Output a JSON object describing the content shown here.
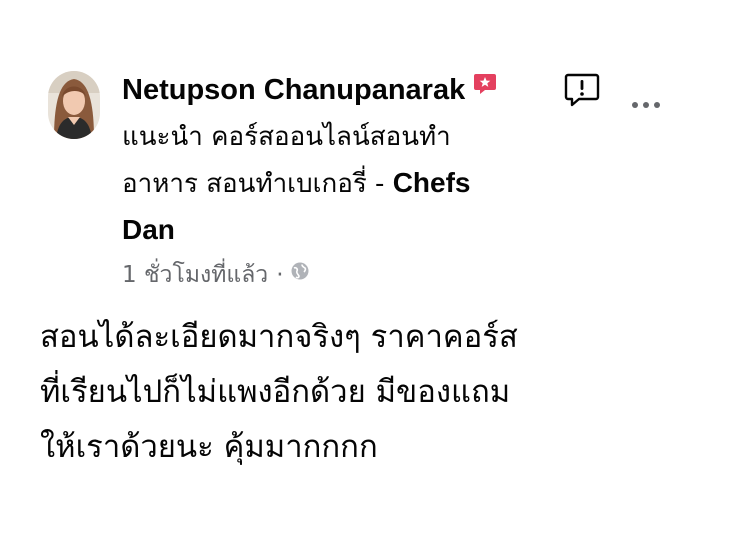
{
  "post": {
    "author": "Netupson Chanupanarak",
    "subtitle_lines": [
      "แนะนำ คอร์สออนไลน์สอนทำ",
      "อาหาร สอนทำเบเกอรี่ - ",
      "Dan"
    ],
    "subtitle_bold": "Chefs",
    "timestamp": "1 ชั่วโมงที่แล้ว",
    "separator": "·",
    "body_lines": [
      "สอนได้ละเอียดมากจริงๆ ราคาคอร์ส",
      "ที่เรียนไปก็ไม่แพงอีกด้วย มีของแถม",
      "ให้เราด้วยนะ คุ้มมากกกก"
    ]
  },
  "icons": {
    "badge": "recommends-badge-icon",
    "report": "report-icon",
    "more": "more-options-icon",
    "audience": "globe-icon"
  },
  "colors": {
    "badge": "#e4405f",
    "meta": "#65676b",
    "text": "#050505"
  }
}
